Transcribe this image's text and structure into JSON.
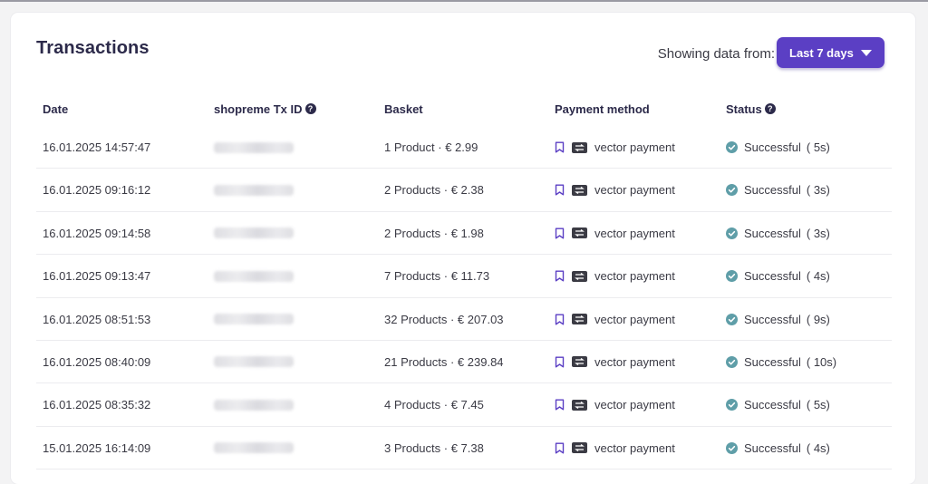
{
  "header": {
    "title": "Transactions",
    "range_label": "Showing data from:",
    "range_value": "Last 7 days"
  },
  "columns": {
    "date": "Date",
    "tx_id": "shopreme Tx ID",
    "basket": "Basket",
    "payment": "Payment method",
    "status": "Status"
  },
  "rows": [
    {
      "date": "16.01.2025 14:57:47",
      "basket": "1 Product · € 2.99",
      "payment": "vector payment",
      "status": "Successful",
      "duration": "( 5s)"
    },
    {
      "date": "16.01.2025 09:16:12",
      "basket": "2 Products · € 2.38",
      "payment": "vector payment",
      "status": "Successful",
      "duration": "( 3s)"
    },
    {
      "date": "16.01.2025 09:14:58",
      "basket": "2 Products · € 1.98",
      "payment": "vector payment",
      "status": "Successful",
      "duration": "( 3s)"
    },
    {
      "date": "16.01.2025 09:13:47",
      "basket": "7 Products · € 11.73",
      "payment": "vector payment",
      "status": "Successful",
      "duration": "( 4s)"
    },
    {
      "date": "16.01.2025 08:51:53",
      "basket": "32 Products · € 207.03",
      "payment": "vector payment",
      "status": "Successful",
      "duration": "( 9s)"
    },
    {
      "date": "16.01.2025 08:40:09",
      "basket": "21 Products · € 239.84",
      "payment": "vector payment",
      "status": "Successful",
      "duration": "( 10s)"
    },
    {
      "date": "16.01.2025 08:35:32",
      "basket": "4 Products · € 7.45",
      "payment": "vector payment",
      "status": "Successful",
      "duration": "( 5s)"
    },
    {
      "date": "15.01.2025 16:14:09",
      "basket": "3 Products · € 7.38",
      "payment": "vector payment",
      "status": "Successful",
      "duration": "( 4s)"
    }
  ],
  "colors": {
    "accent": "#5b3fc4",
    "title": "#2c2a4a",
    "success": "#5f9ea8",
    "bookmark": "#5b3fc4"
  }
}
